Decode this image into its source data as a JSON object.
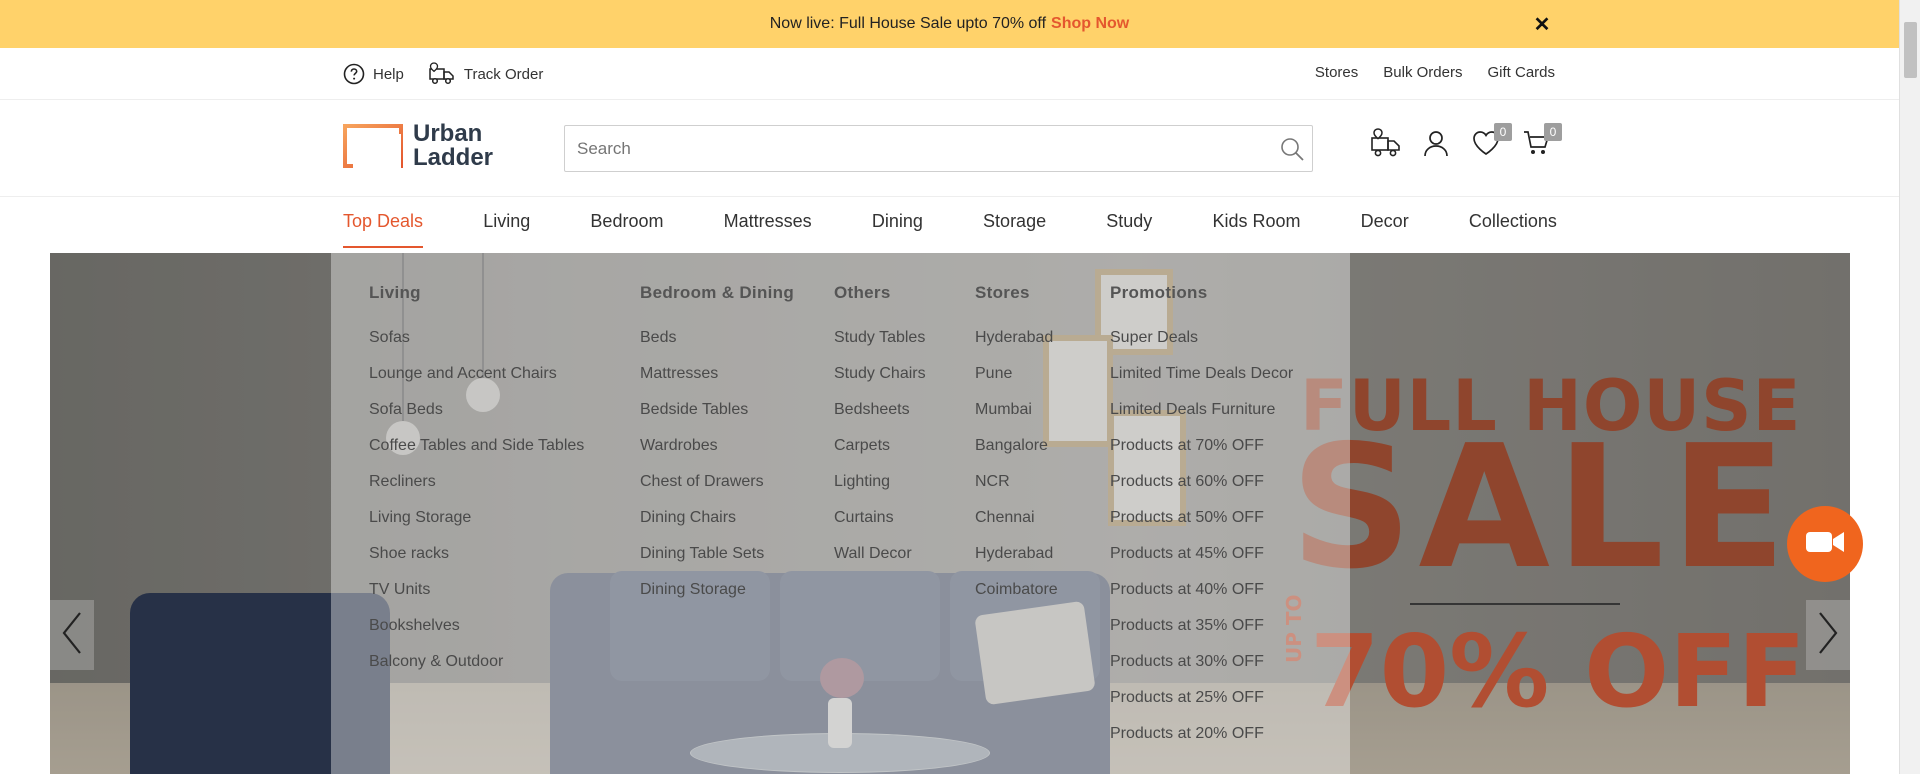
{
  "announcement": {
    "text": "Now live: Full House Sale upto 70% off",
    "cta": "Shop Now",
    "close_icon": "close-icon"
  },
  "utility": {
    "help": "Help",
    "track_order": "Track Order",
    "stores": "Stores",
    "bulk_orders": "Bulk Orders",
    "gift_cards": "Gift Cards"
  },
  "header": {
    "logo_line1": "Urban",
    "logo_line2": "Ladder",
    "search_placeholder": "Search",
    "wishlist_count": "0",
    "cart_count": "0"
  },
  "nav": {
    "items": [
      "Top Deals",
      "Living",
      "Bedroom",
      "Mattresses",
      "Dining",
      "Storage",
      "Study",
      "Kids Room",
      "Decor",
      "Collections"
    ],
    "active": "Top Deals"
  },
  "mega_menu": {
    "living": {
      "title": "Living",
      "items": [
        "Sofas",
        "Lounge and Accent Chairs",
        "Sofa Beds",
        "Coffee Tables and Side Tables",
        "Recliners",
        "Living Storage",
        "Shoe racks",
        "TV Units",
        "Bookshelves",
        "Balcony & Outdoor"
      ]
    },
    "bedroom_dining": {
      "title": "Bedroom & Dining",
      "items": [
        "Beds",
        "Mattresses",
        "Bedside Tables",
        "Wardrobes",
        "Chest of Drawers",
        "Dining Chairs",
        "Dining Table Sets",
        "Dining Storage"
      ]
    },
    "others": {
      "title": "Others",
      "items": [
        "Study Tables",
        "Study Chairs",
        "Bedsheets",
        "Carpets",
        "Lighting",
        "Curtains",
        "Wall Decor"
      ]
    },
    "stores": {
      "title": "Stores",
      "items": [
        "Hyderabad",
        "Pune",
        "Mumbai",
        "Bangalore",
        "NCR",
        "Chennai",
        "Hyderabad",
        "Coimbatore"
      ]
    },
    "promotions": {
      "title": "Promotions",
      "items": [
        "Super Deals",
        "Limited Time Deals Decor",
        "Limited Deals Furniture",
        "Products at 70% OFF",
        "Products at 60% OFF",
        "Products at 50% OFF",
        "Products at 45% OFF",
        "Products at 40% OFF",
        "Products at 35% OFF",
        "Products at 30% OFF",
        "Products at 25% OFF",
        "Products at 20% OFF"
      ]
    }
  },
  "hero": {
    "line1": "FULL HOUSE",
    "line2": "SALE",
    "upto": "UP TO",
    "discount": "70% OFF"
  },
  "colors": {
    "accent": "#e4572e",
    "announce_bg": "#ffd26a",
    "video_button": "#f0651e"
  }
}
